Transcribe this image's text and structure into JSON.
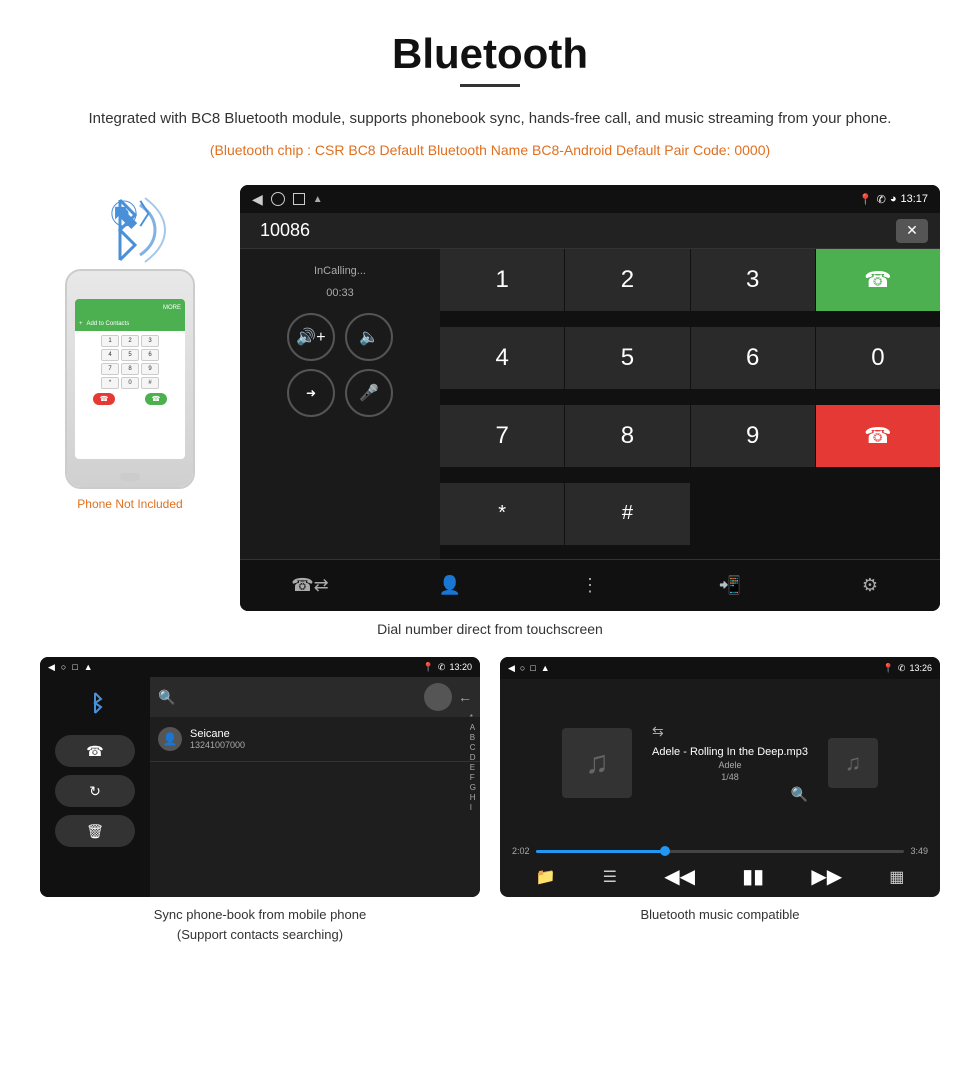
{
  "page": {
    "title": "Bluetooth",
    "title_underline": true
  },
  "description": {
    "main": "Integrated with BC8 Bluetooth module, supports phonebook sync, hands-free call, and music streaming from your phone.",
    "specs": "(Bluetooth chip : CSR BC8    Default Bluetooth Name BC8-Android    Default Pair Code: 0000)"
  },
  "dial_screen": {
    "status_bar": {
      "time": "13:17",
      "icons": "location, phone, wifi"
    },
    "number": "10086",
    "calling_label": "InCalling...",
    "timer": "00:33",
    "numpad": {
      "keys": [
        "1",
        "2",
        "3",
        "*",
        "4",
        "5",
        "6",
        "0",
        "7",
        "8",
        "9",
        "#"
      ],
      "call_answer": "☎",
      "call_end": "☎"
    }
  },
  "caption_dial": "Dial number direct from touchscreen",
  "phonebook_screen": {
    "status_bar": {
      "time": "13:20"
    },
    "contact": {
      "name": "Seicane",
      "number": "13241007000"
    },
    "alphabet": [
      "*",
      "A",
      "B",
      "C",
      "D",
      "E",
      "F",
      "G",
      "H",
      "I"
    ]
  },
  "caption_phonebook": "Sync phone-book from mobile phone\n(Support contacts searching)",
  "music_screen": {
    "status_bar": {
      "time": "13:26"
    },
    "song": "Adele - Rolling In the Deep.mp3",
    "artist": "Adele",
    "track_info": "1/48",
    "time_current": "2:02",
    "time_total": "3:49",
    "progress_percent": 35
  },
  "caption_music": "Bluetooth music compatible",
  "phone_not_included": "Phone Not Included",
  "bottom_nav": {
    "items": [
      "📞",
      "👤",
      "⊞",
      "📱",
      "⚙"
    ]
  }
}
